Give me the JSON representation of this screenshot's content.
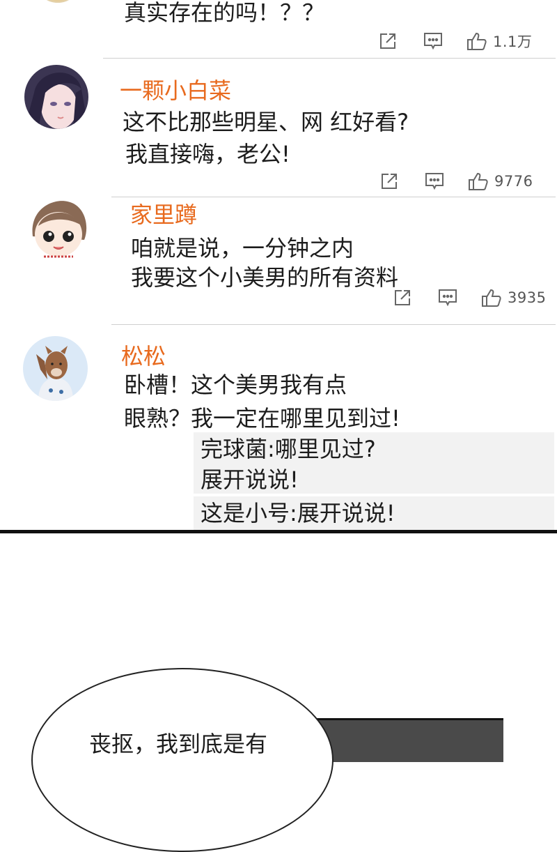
{
  "comments": [
    {
      "text_lines": [
        "真实存在的吗！？？"
      ],
      "likes": "1.1万"
    },
    {
      "username": "一颗小白菜",
      "text_lines": [
        "这不比那些明星、网 红好看?",
        "我直接嗨，老公!"
      ],
      "likes": "9776"
    },
    {
      "username": "家里蹲",
      "text_lines": [
        "咱就是说，一分钟之内",
        "我要这个小美男的所有资料"
      ],
      "likes": "3935"
    },
    {
      "username": "松松",
      "text_lines": [
        "卧槽！这个美男我有点",
        "眼熟？我一定在哪里见到过!"
      ],
      "replies": [
        {
          "lines": [
            "完球菌:哪里见过?",
            "展开说说!"
          ]
        },
        {
          "lines": [
            "这是小号:展开说说!"
          ]
        }
      ]
    }
  ],
  "icons": [
    "share-icon",
    "comment-icon",
    "like-icon"
  ],
  "bubble": {
    "text": "丧抠，我到底是有"
  },
  "colors": {
    "username": "#e86a1e",
    "reply_bg": "#f2f2f2",
    "divider": "#cfcfcf",
    "icon": "#555555"
  }
}
